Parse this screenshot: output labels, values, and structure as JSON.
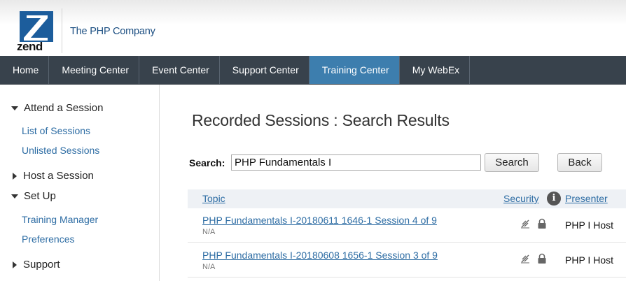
{
  "header": {
    "logo_text": "zend",
    "tagline": "The PHP Company"
  },
  "nav": {
    "tabs": [
      {
        "label": "Home",
        "active": false
      },
      {
        "label": "Meeting Center",
        "active": false
      },
      {
        "label": "Event Center",
        "active": false
      },
      {
        "label": "Support Center",
        "active": false
      },
      {
        "label": "Training Center",
        "active": true
      },
      {
        "label": "My WebEx",
        "active": false
      }
    ]
  },
  "sidebar": {
    "attend": {
      "label": "Attend a Session",
      "links": [
        "List of Sessions",
        "Unlisted Sessions"
      ]
    },
    "host": {
      "label": "Host a Session"
    },
    "setup": {
      "label": "Set Up",
      "links": [
        "Training Manager",
        "Preferences"
      ]
    },
    "support": {
      "label": "Support"
    }
  },
  "main": {
    "title": "Recorded Sessions : Search Results",
    "search_label": "Search:",
    "search_value": "PHP Fundamentals I",
    "search_button": "Search",
    "back_button": "Back",
    "columns": {
      "topic": "Topic",
      "security": "Security",
      "presenter": "Presenter"
    },
    "rows": [
      {
        "topic": "PHP Fundamentals I-20180611 1646-1 Session 4 of 9",
        "sub": "N/A",
        "presenter": "PHP I Host"
      },
      {
        "topic": "PHP Fundamentals I-20180608 1656-1 Session 3 of 9",
        "sub": "N/A",
        "presenter": "PHP I Host"
      }
    ]
  },
  "colors": {
    "nav_bg": "#38424c",
    "nav_active": "#3d7eae",
    "link": "#2e6da4",
    "brand": "#1c4f82"
  }
}
